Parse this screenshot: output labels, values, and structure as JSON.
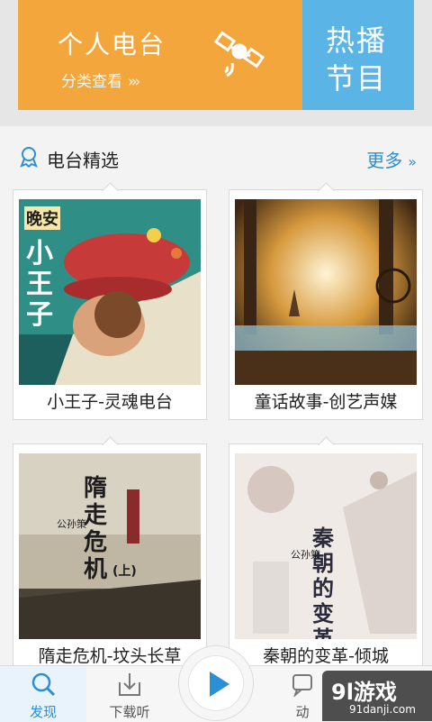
{
  "banner": {
    "personal_radio": {
      "title": "个人电台",
      "subtitle": "分类查看",
      "chevron": "›››"
    },
    "hot_programs": {
      "line1": "热播",
      "line2": "节目"
    }
  },
  "section": {
    "title": "电台精选",
    "more_label": "更多",
    "more_chevron": "››"
  },
  "cards": [
    {
      "caption": "小王子-灵魂电台",
      "cover_text": [
        "晚安",
        "小王子"
      ]
    },
    {
      "caption": "童话故事-创艺声媒"
    },
    {
      "caption": "隋走危机-坟头长草",
      "cover_text": [
        "隋走危机",
        "(上)",
        "公孙策"
      ]
    },
    {
      "caption": "秦朝的变革-倾城",
      "cover_text": [
        "秦朝的变革",
        "公孙策"
      ]
    }
  ],
  "bottom_nav": {
    "discover": "发现",
    "download": "下载听",
    "dynamic": "动"
  },
  "watermark": {
    "main": "9l游戏",
    "sub": "91danji.com"
  },
  "colors": {
    "orange": "#f3a63b",
    "blue": "#5ab5e6",
    "accent": "#2a8fd4"
  }
}
